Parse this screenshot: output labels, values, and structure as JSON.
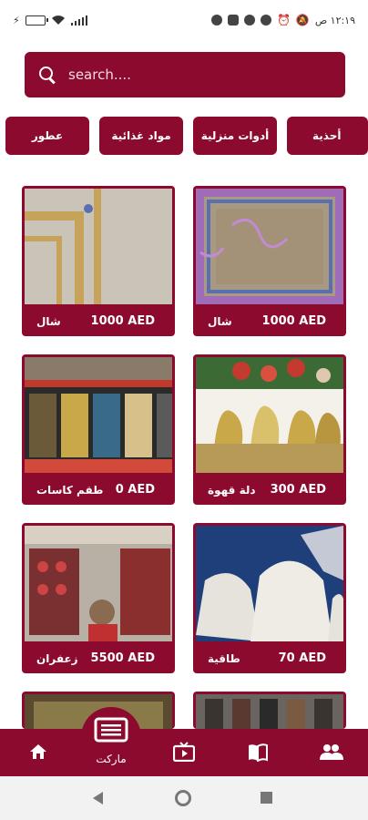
{
  "status_bar": {
    "time": "١٢:١٩ ص",
    "battery_color": "#3cb043"
  },
  "search": {
    "placeholder": "search...."
  },
  "categories": [
    {
      "label": "أحذية"
    },
    {
      "label": "أدوات منزلية"
    },
    {
      "label": "مواد غذائية"
    },
    {
      "label": "عطور"
    }
  ],
  "products": [
    {
      "name": "شال",
      "price": "1000 AED",
      "image": "embroidered-shawl-pink"
    },
    {
      "name": "شال",
      "price": "1000 AED",
      "image": "embroidered-shawl-gold"
    },
    {
      "name": "دلة قهوة",
      "price": "300 AED",
      "image": "coffee-pots"
    },
    {
      "name": "طقم كاسات",
      "price": "0 AED",
      "image": "cup-sets"
    },
    {
      "name": "طاقية",
      "price": "70 AED",
      "image": "caps"
    },
    {
      "name": "زعفران",
      "price": "5500 AED",
      "image": "saffron-shop"
    },
    {
      "name": "",
      "price": "",
      "image": "belts"
    },
    {
      "name": "",
      "price": "",
      "image": "mat"
    }
  ],
  "bottom_nav": {
    "market_label": "ماركت",
    "items": [
      "people-icon",
      "book-icon",
      "tv-icon",
      "market-icon",
      "home-icon"
    ]
  },
  "colors": {
    "brand": "#8b0a2e",
    "chip_text": "#ffffff"
  }
}
